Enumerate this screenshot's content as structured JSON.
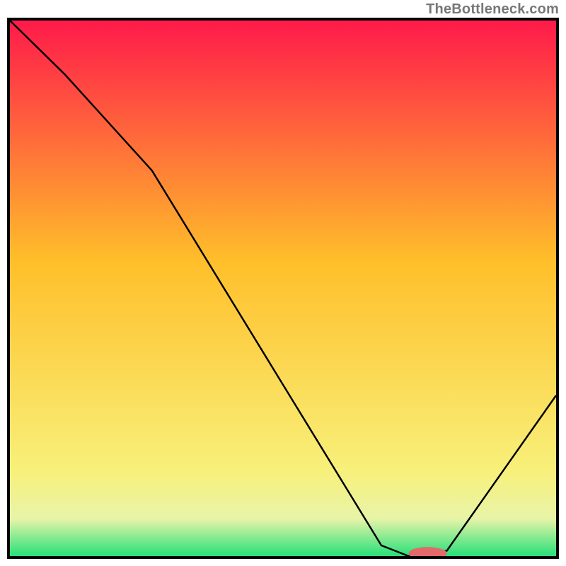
{
  "watermark": "TheBottleneck.com",
  "colors": {
    "frame": "#000000",
    "curve": "#000000",
    "marker_fill": "#e26a6a",
    "gradient_top": "#ff1a4a",
    "gradient_mid": "#ffbf2a",
    "gradient_low1": "#f8f07a",
    "gradient_low2": "#e8f4a8",
    "gradient_bottom": "#28e07a"
  },
  "chart_data": {
    "type": "line",
    "title": "",
    "xlabel": "",
    "ylabel": "",
    "xlim": [
      0,
      100
    ],
    "ylim": [
      0,
      100
    ],
    "x": [
      0,
      10,
      26,
      68,
      73,
      80,
      100
    ],
    "values": [
      100,
      90,
      72,
      2,
      0,
      1,
      30
    ],
    "marker": {
      "x": 76.5,
      "y": 0.5,
      "rx": 3.5,
      "ry": 1.2
    },
    "note": "y-axis is inverted visually (0 at bottom = green, 100 at top = red). values are bottleneck-like magnitudes; curve dips to 0 near x≈73-80."
  }
}
